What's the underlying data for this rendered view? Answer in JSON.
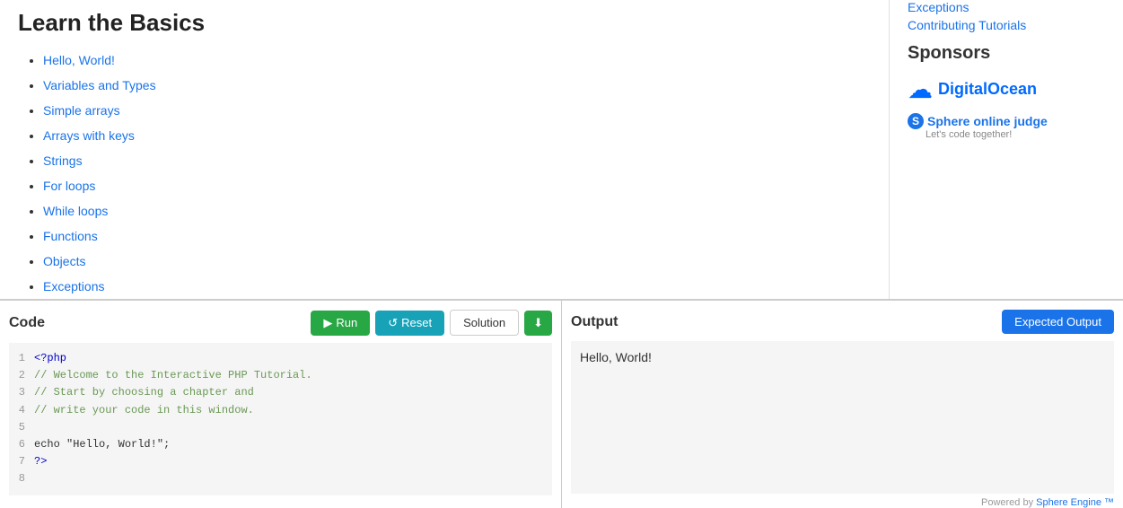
{
  "page": {
    "title": "Learn the Basics"
  },
  "nav_list": {
    "items": [
      {
        "label": "Hello, World!",
        "href": "#"
      },
      {
        "label": "Variables and Types",
        "href": "#"
      },
      {
        "label": "Simple arrays",
        "href": "#"
      },
      {
        "label": "Arrays with keys",
        "href": "#"
      },
      {
        "label": "Strings",
        "href": "#"
      },
      {
        "label": "For loops",
        "href": "#"
      },
      {
        "label": "While loops",
        "href": "#"
      },
      {
        "label": "Functions",
        "href": "#"
      },
      {
        "label": "Objects",
        "href": "#"
      },
      {
        "label": "Exceptions",
        "href": "#"
      }
    ]
  },
  "code_panel": {
    "title": "Code",
    "run_label": "Run",
    "reset_label": "Reset",
    "solution_label": "Solution",
    "lines": [
      {
        "num": "1",
        "code": "<?php"
      },
      {
        "num": "2",
        "code": "// Welcome to the Interactive PHP Tutorial."
      },
      {
        "num": "3",
        "code": "// Start by choosing a chapter and"
      },
      {
        "num": "4",
        "code": "// write your code in this window."
      },
      {
        "num": "5",
        "code": ""
      },
      {
        "num": "6",
        "code": "echo \"Hello, World!\";"
      },
      {
        "num": "7",
        "code": "?>"
      },
      {
        "num": "8",
        "code": ""
      }
    ]
  },
  "output_panel": {
    "title": "Output",
    "expected_label": "Expected Output",
    "output_text": "Hello, World!",
    "powered_by": "Powered by",
    "sphere_engine": "Sphere Engine ™"
  },
  "sidebar": {
    "exceptions_label": "Exceptions",
    "contributing_label": "Contributing Tutorials",
    "sponsors_title": "Sponsors",
    "digitalocean_label": "DigitalOcean",
    "sphere_label": "Sphere online judge",
    "sphere_sub": "Let's code together!"
  }
}
